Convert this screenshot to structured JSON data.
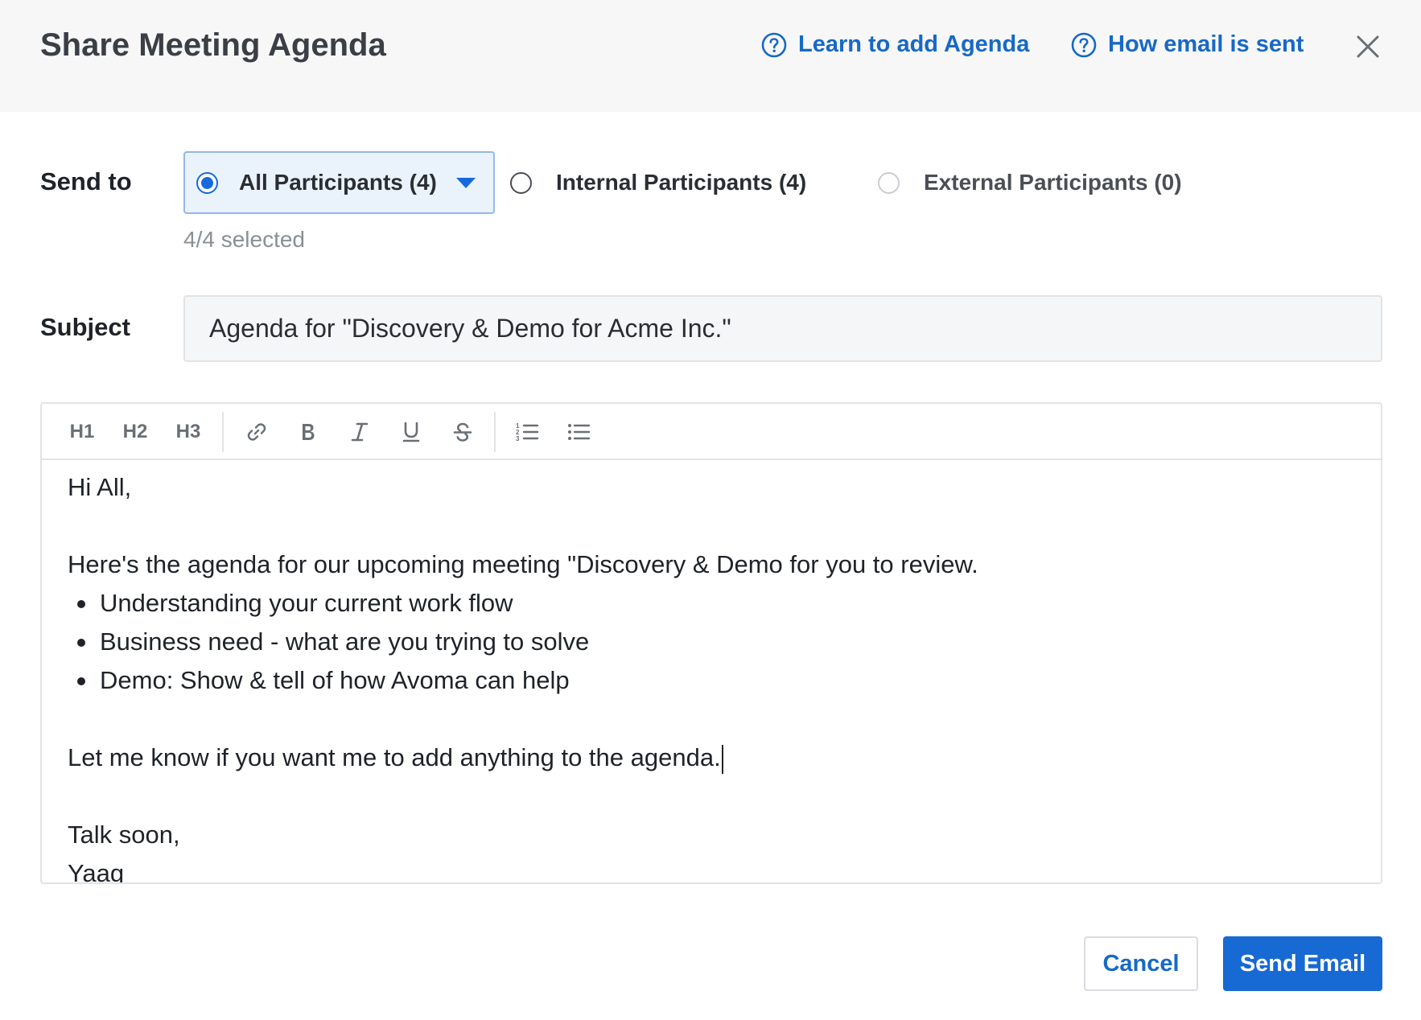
{
  "dialog": {
    "title": "Share Meeting Agenda",
    "help_links": [
      {
        "label": "Learn to add Agenda",
        "icon": "question-circle-icon"
      },
      {
        "label": "How email is sent",
        "icon": "question-circle-icon"
      }
    ],
    "close_icon": "close-icon"
  },
  "send_to": {
    "label": "Send to",
    "options": [
      {
        "label": "All Participants (4)",
        "selected": true,
        "has_dropdown": true
      },
      {
        "label": "Internal Participants (4)",
        "selected": false
      },
      {
        "label": "External Participants (0)",
        "selected": false,
        "disabled": true
      }
    ],
    "selected_count": "4/4 selected"
  },
  "subject": {
    "label": "Subject",
    "value": "Agenda for \"Discovery & Demo for Acme Inc.\""
  },
  "editor": {
    "toolbar": [
      "H1",
      "H2",
      "H3",
      "link-icon",
      "bold-icon",
      "italic-icon",
      "underline-icon",
      "strikethrough-icon",
      "ordered-list-icon",
      "bullet-list-icon"
    ],
    "body": {
      "greeting": "Hi All,",
      "intro": "Here's the agenda for our upcoming meeting \"Discovery & Demo for you to review.",
      "items": [
        "Understanding your current work flow",
        "Business need - what are you trying to solve",
        "Demo: Show & tell of how Avoma can help"
      ],
      "closing_line": "Let me know if you want me to add anything to the agenda.",
      "signoff": "Talk soon,",
      "signature": "Yaag"
    }
  },
  "actions": {
    "cancel_label": "Cancel",
    "send_label": "Send Email"
  },
  "colors": {
    "accent": "#1769d4",
    "link": "#1769c4",
    "header_bg": "#f7f7f8"
  }
}
